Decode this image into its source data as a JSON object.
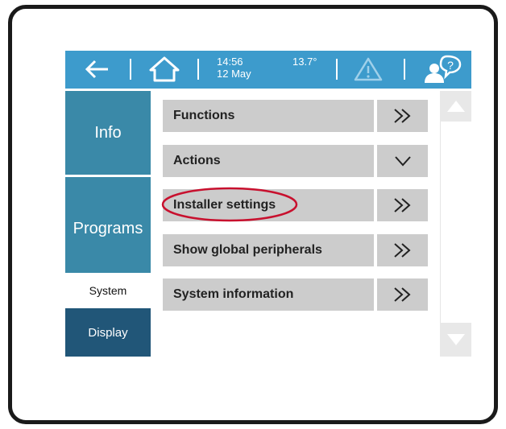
{
  "status_bar": {
    "time": "14:56",
    "date": "12 May",
    "temperature": "13.7°"
  },
  "icons": {
    "back": "back-arrow-icon",
    "home": "home-icon",
    "warning": "warning-icon",
    "help": "user-help-icon",
    "expand": "double-chevron-right-icon",
    "collapse": "chevron-down-icon",
    "scroll_up": "triangle-up-icon",
    "scroll_down": "triangle-down-icon"
  },
  "tabs": [
    {
      "label": "Info"
    },
    {
      "label": "Programs"
    },
    {
      "label": "System",
      "selected": true
    },
    {
      "label": "Display"
    }
  ],
  "menu": [
    {
      "label": "Functions",
      "indicator": "expand"
    },
    {
      "label": "Actions",
      "indicator": "collapse"
    },
    {
      "label": "Installer settings",
      "indicator": "expand",
      "highlighted": true
    },
    {
      "label": "Show global peripherals",
      "indicator": "expand"
    },
    {
      "label": "System information",
      "indicator": "expand"
    }
  ],
  "colors": {
    "header_blue": "#3d9bcc",
    "tab_teal": "#3a89a8",
    "tab_dark": "#215678",
    "row_grey": "#cccccc",
    "highlight_red": "#c8102e"
  }
}
